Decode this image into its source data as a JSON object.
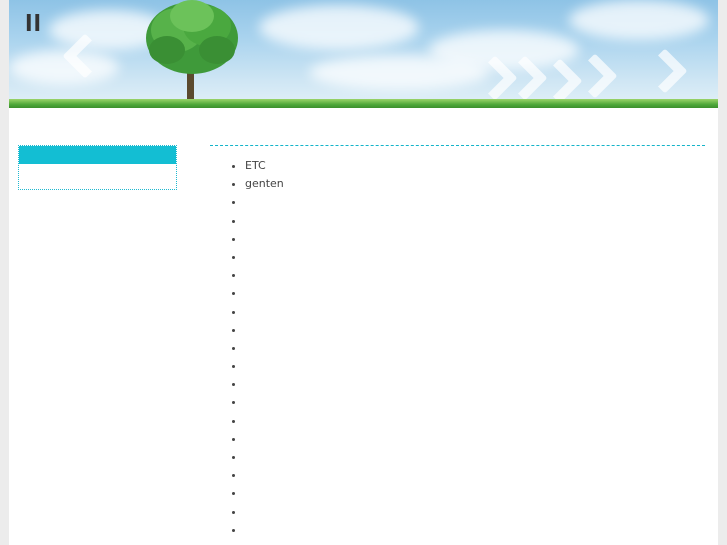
{
  "header": {
    "title": "ll"
  },
  "sidebar": {
    "box_heading": ""
  },
  "content": {
    "list_items": [
      "ETC",
      "genten",
      "",
      "",
      "",
      "",
      "",
      "",
      "",
      "",
      "",
      "",
      "",
      "",
      "",
      "",
      "",
      "",
      "",
      "",
      ""
    ]
  },
  "colors": {
    "accent": "#13bed3",
    "page_background": "#ececec",
    "text": "#444444"
  }
}
